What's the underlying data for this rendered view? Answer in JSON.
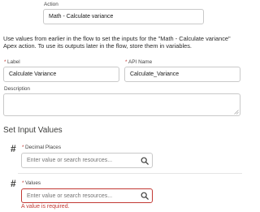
{
  "action": {
    "label": "Action",
    "value": "Math - Calculate variance"
  },
  "description": "Use values from earlier in the flow to set the inputs for the \"Math - Calculate variance\" Apex action. To use its outputs later in the flow, store them in variables.",
  "form": {
    "label_field": {
      "label": "Label",
      "value": "Calculate Variance",
      "required": "*"
    },
    "api_name_field": {
      "label": "API Name",
      "value": "Calculate_Variance",
      "required": "*"
    },
    "description_field": {
      "label": "Description",
      "value": ""
    }
  },
  "input_values": {
    "section_title": "Set Input Values",
    "decimal_places": {
      "type_icon": "#",
      "required": "*",
      "label": "Decimal Places",
      "placeholder": "Enter value or search resources..."
    },
    "values": {
      "type_icon": "#",
      "required": "*",
      "label": "Values",
      "placeholder": "Enter value or search resources...",
      "error": "A value is required."
    }
  },
  "colors": {
    "error": "#c23934",
    "border": "#c9c9c9",
    "divider": "#e5e5e5"
  },
  "icons": {
    "search": "search-icon",
    "resize": "resize-handle-icon",
    "type": "number-type-icon"
  }
}
